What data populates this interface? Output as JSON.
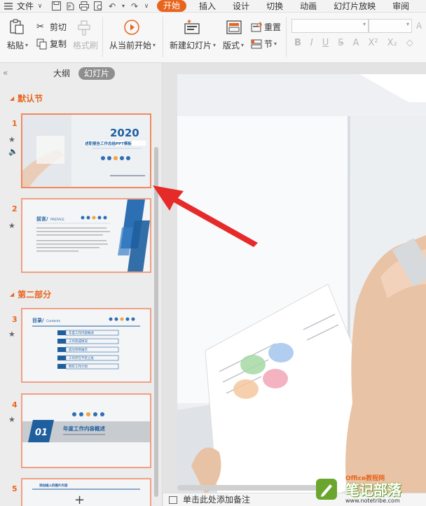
{
  "menubar": {
    "file": "文件",
    "tabs": [
      "开始",
      "插入",
      "设计",
      "切换",
      "动画",
      "幻灯片放映",
      "审阅"
    ],
    "active_tab": "开始"
  },
  "ribbon": {
    "paste": "粘贴",
    "cut": "剪切",
    "copy": "复制",
    "format_painter": "格式刷",
    "from_current": "从当前开始",
    "new_slide": "新建幻灯片",
    "layout": "版式",
    "reset": "重置",
    "section": "节"
  },
  "panel": {
    "outline_tab": "大纲",
    "slides_tab": "幻灯片",
    "section1": "默认节",
    "section2": "第二部分"
  },
  "slides": [
    {
      "num": "1",
      "year": "2020",
      "title": "述职报告工作总结PPT模板"
    },
    {
      "num": "2",
      "title": "前言/",
      "subtitle": "PREFACE"
    },
    {
      "num": "3",
      "title": "目录/",
      "subtitle": "Contents",
      "items": [
        "年度工作内容概述",
        "工作完成情况",
        "成功项目展示",
        "工作存在不足之处",
        "明年工作计划"
      ]
    },
    {
      "num": "4",
      "chapter": "01",
      "title": "年度工作内容概述"
    },
    {
      "num": "5",
      "title": "添加插入的图片内容"
    }
  ],
  "notes_placeholder": "单击此处添加备注",
  "watermark": {
    "title": "笔记部落",
    "url": "www.notetribe.com",
    "badge": "Office教程网"
  },
  "colors": {
    "accent": "#e8651e",
    "blue": "#1f5f9e"
  }
}
